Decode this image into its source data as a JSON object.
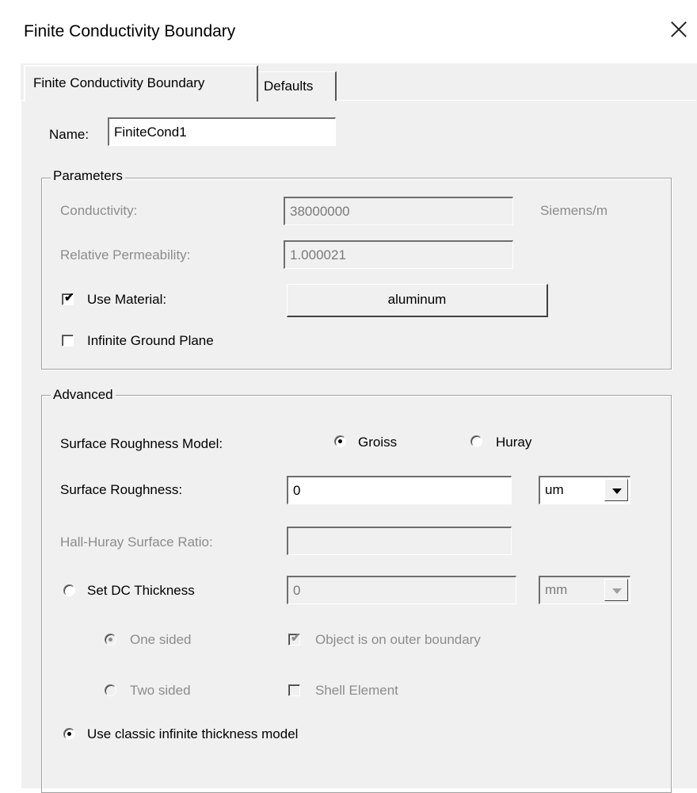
{
  "window": {
    "title": "Finite Conductivity Boundary"
  },
  "tabs": [
    {
      "label": "Finite Conductivity Boundary"
    },
    {
      "label": "Defaults"
    }
  ],
  "name": {
    "label": "Name:",
    "value": "FiniteCond1"
  },
  "parameters": {
    "title": "Parameters",
    "conductivity_label": "Conductivity:",
    "conductivity_value": "38000000",
    "conductivity_unit": "Siemens/m",
    "permeability_label": "Relative Permeability:",
    "permeability_value": "1.000021",
    "use_material_label": "Use Material:",
    "use_material_checked": true,
    "material_button": "aluminum",
    "infinite_ground_label": "Infinite Ground Plane",
    "infinite_ground_checked": false
  },
  "advanced": {
    "title": "Advanced",
    "roughness_model_label": "Surface Roughness Model:",
    "model_options": [
      "Groiss",
      "Huray"
    ],
    "model_selected": "Groiss",
    "roughness_label": "Surface Roughness:",
    "roughness_value": "0",
    "roughness_unit": "um",
    "hall_huray_label": "Hall-Huray Surface Ratio:",
    "hall_huray_value": "",
    "dc_thickness_label": "Set DC Thickness",
    "dc_thickness_value": "0",
    "dc_thickness_unit": "mm",
    "one_sided_label": "One sided",
    "two_sided_label": "Two sided",
    "outer_boundary_label": "Object is on outer boundary",
    "outer_boundary_checked": true,
    "shell_element_label": "Shell Element",
    "shell_element_checked": false,
    "classic_model_label": "Use classic infinite thickness model",
    "classic_model_selected": true
  }
}
